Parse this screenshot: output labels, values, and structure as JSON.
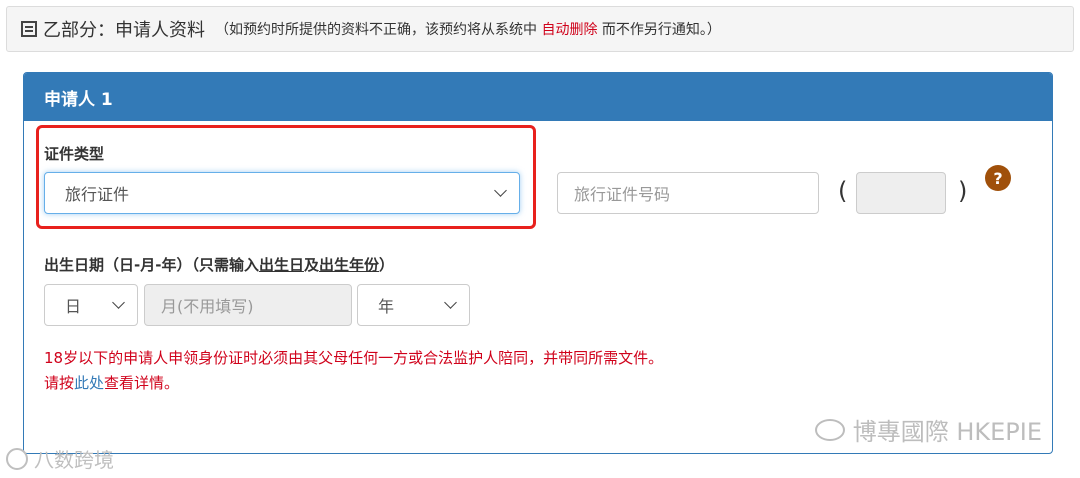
{
  "section": {
    "title": "乙部分：申请人资料",
    "note_prefix": "（如预约时所提供的资料不正确，该预约将从系统中",
    "note_red": "自动删除",
    "note_suffix": "而不作另行通知。）"
  },
  "panel": {
    "title": "申请人 1",
    "doc_type_label": "证件类型",
    "doc_type_value": "旅行证件",
    "doc_number_placeholder": "旅行证件号码",
    "paren_open": "(",
    "paren_close": ")",
    "help_symbol": "?",
    "dob_label_prefix": "出生日期（日-月-年）（只需输入",
    "dob_label_u1": "出生日",
    "dob_label_mid": "及",
    "dob_label_u2": "出生年份",
    "dob_label_suffix": "）",
    "day_value": "日",
    "month_placeholder": "月(不用填写)",
    "year_value": "年",
    "warning_line1": "18岁以下的申请人申领身份证时必须由其父母任何一方或合法监护人陪同，并带同所需文件。",
    "warning_line2_prefix": "请按",
    "warning_link": "此处",
    "warning_line2_suffix": "查看详情。"
  },
  "watermarks": {
    "brand": "博專國際 HKEPIE",
    "source": "八数跨境"
  },
  "colors": {
    "primary": "#337ab7",
    "danger": "#d0021b",
    "highlight": "#e8211d",
    "help": "#a0500a"
  }
}
